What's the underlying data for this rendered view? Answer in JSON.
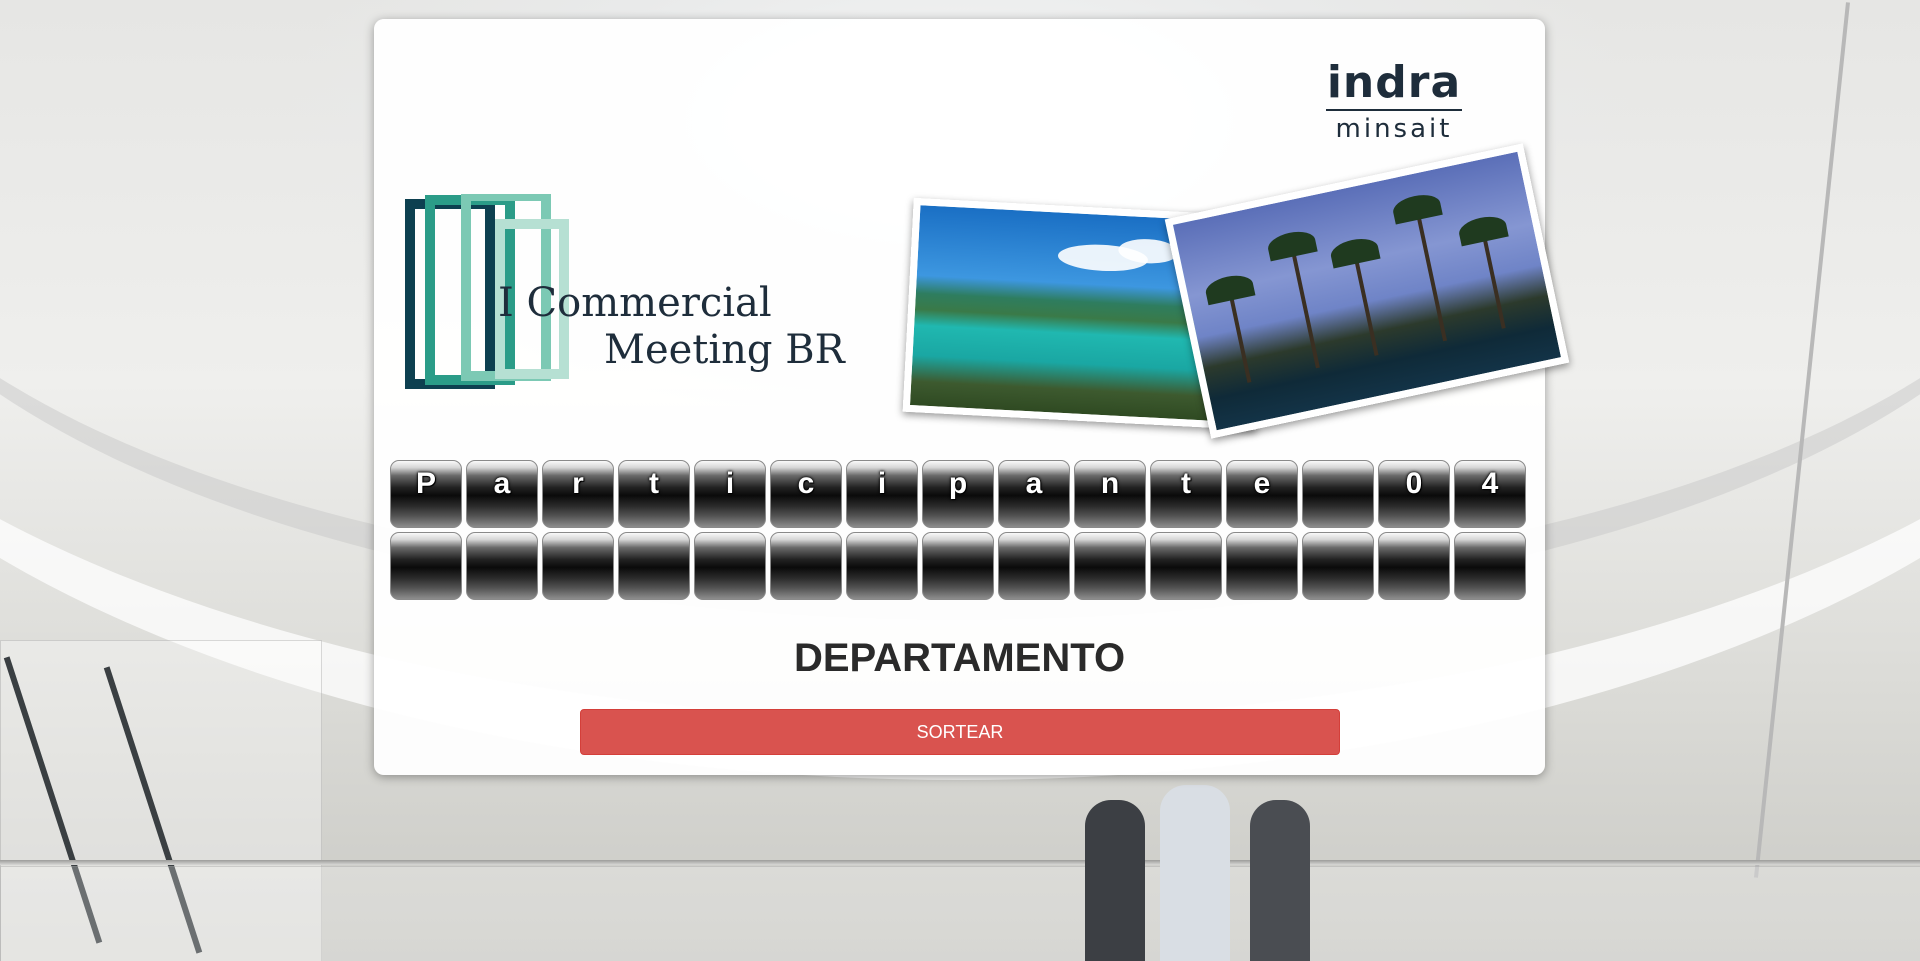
{
  "background": {
    "scene": "office-atrium-people"
  },
  "branding": {
    "indra_logo_text": "indra",
    "minsait_logo_text": "minsait",
    "event_title_line1": "I Commercial",
    "event_title_line2": "Meeting BR",
    "event_logo_colors": [
      "#0d4050",
      "#2b9c88",
      "#7cc9b4",
      "#b6e0d3"
    ]
  },
  "photos": [
    {
      "name": "beach-photo"
    },
    {
      "name": "palm-trees-photo"
    }
  ],
  "board": {
    "row1": [
      "P",
      "a",
      "r",
      "t",
      "i",
      "c",
      "i",
      "p",
      "a",
      "n",
      "t",
      "e",
      "",
      "0",
      "4"
    ],
    "row2": [
      "",
      "",
      "",
      "",
      "",
      "",
      "",
      "",
      "",
      "",
      "",
      "",
      "",
      "",
      ""
    ]
  },
  "department_label": "DEPARTAMENTO",
  "draw_button_label": "SORTEAR",
  "colors": {
    "button": "#d9534f",
    "text_dark": "#1e2d3b"
  }
}
